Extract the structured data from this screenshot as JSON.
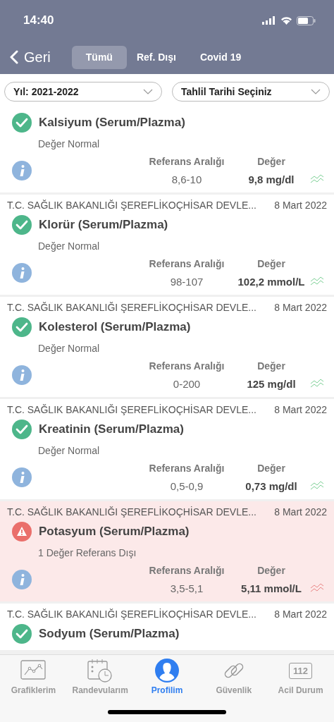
{
  "status_bar": {
    "time": "14:40"
  },
  "nav": {
    "back": "Geri",
    "tabs": [
      {
        "label": "Tümü",
        "selected": true
      },
      {
        "label": "Ref. Dışı",
        "selected": false
      },
      {
        "label": "Covid 19",
        "selected": false
      }
    ]
  },
  "filters": [
    {
      "value": "Yıl: 2021-2022"
    },
    {
      "value": "Tahlil Tarihi Seçiniz"
    }
  ],
  "results": [
    {
      "name": "Kalsiyum (Serum/Plazma)",
      "out_of_range": false,
      "status_text": "Değer Normal",
      "ref_label": "Referans Aralığı",
      "value_label": "Değer",
      "range": "8,6-10",
      "value": "9,8 mg/dl"
    },
    {
      "hospital": "T.C. SAĞLIK BAKANLIĞI ŞEREFLİKOÇHİSAR DEVLE...",
      "date": "8 Mart 2022",
      "name": "Klorür (Serum/Plazma)",
      "out_of_range": false,
      "status_text": "Değer Normal",
      "ref_label": "Referans Aralığı",
      "value_label": "Değer",
      "range": "98-107",
      "value": "102,2 mmol/L"
    },
    {
      "hospital": "T.C. SAĞLIK BAKANLIĞI ŞEREFLİKOÇHİSAR DEVLE...",
      "date": "8 Mart 2022",
      "name": "Kolesterol (Serum/Plazma)",
      "out_of_range": false,
      "status_text": "Değer Normal",
      "ref_label": "Referans Aralığı",
      "value_label": "Değer",
      "range": "0-200",
      "value": "125 mg/dl"
    },
    {
      "hospital": "T.C. SAĞLIK BAKANLIĞI ŞEREFLİKOÇHİSAR DEVLE...",
      "date": "8 Mart 2022",
      "name": "Kreatinin (Serum/Plazma)",
      "out_of_range": false,
      "status_text": "Değer Normal",
      "ref_label": "Referans Aralığı",
      "value_label": "Değer",
      "range": "0,5-0,9",
      "value": "0,73 mg/dl"
    },
    {
      "hospital": "T.C. SAĞLIK BAKANLIĞI ŞEREFLİKOÇHİSAR DEVLE...",
      "date": "8 Mart 2022",
      "name": "Potasyum (Serum/Plazma)",
      "out_of_range": true,
      "status_text": "1 Değer Referans Dışı",
      "ref_label": "Referans Aralığı",
      "value_label": "Değer",
      "range": "3,5-5,1",
      "value": "5,11 mmol/L"
    },
    {
      "hospital": "T.C. SAĞLIK BAKANLIĞI ŞEREFLİKOÇHİSAR DEVLE...",
      "date": "8 Mart 2022",
      "name": "Sodyum (Serum/Plazma)",
      "out_of_range": false
    }
  ],
  "tab_bar": [
    {
      "kind": "chart",
      "label": "Grafiklerim",
      "selected": false
    },
    {
      "kind": "calendar",
      "label": "Randevularım",
      "selected": false
    },
    {
      "kind": "person",
      "label": "Profilim",
      "selected": true
    },
    {
      "kind": "link",
      "label": "Güvenlik",
      "selected": false
    },
    {
      "kind": "badge",
      "badge": "112",
      "label": "Acil Durum",
      "selected": false
    }
  ]
}
